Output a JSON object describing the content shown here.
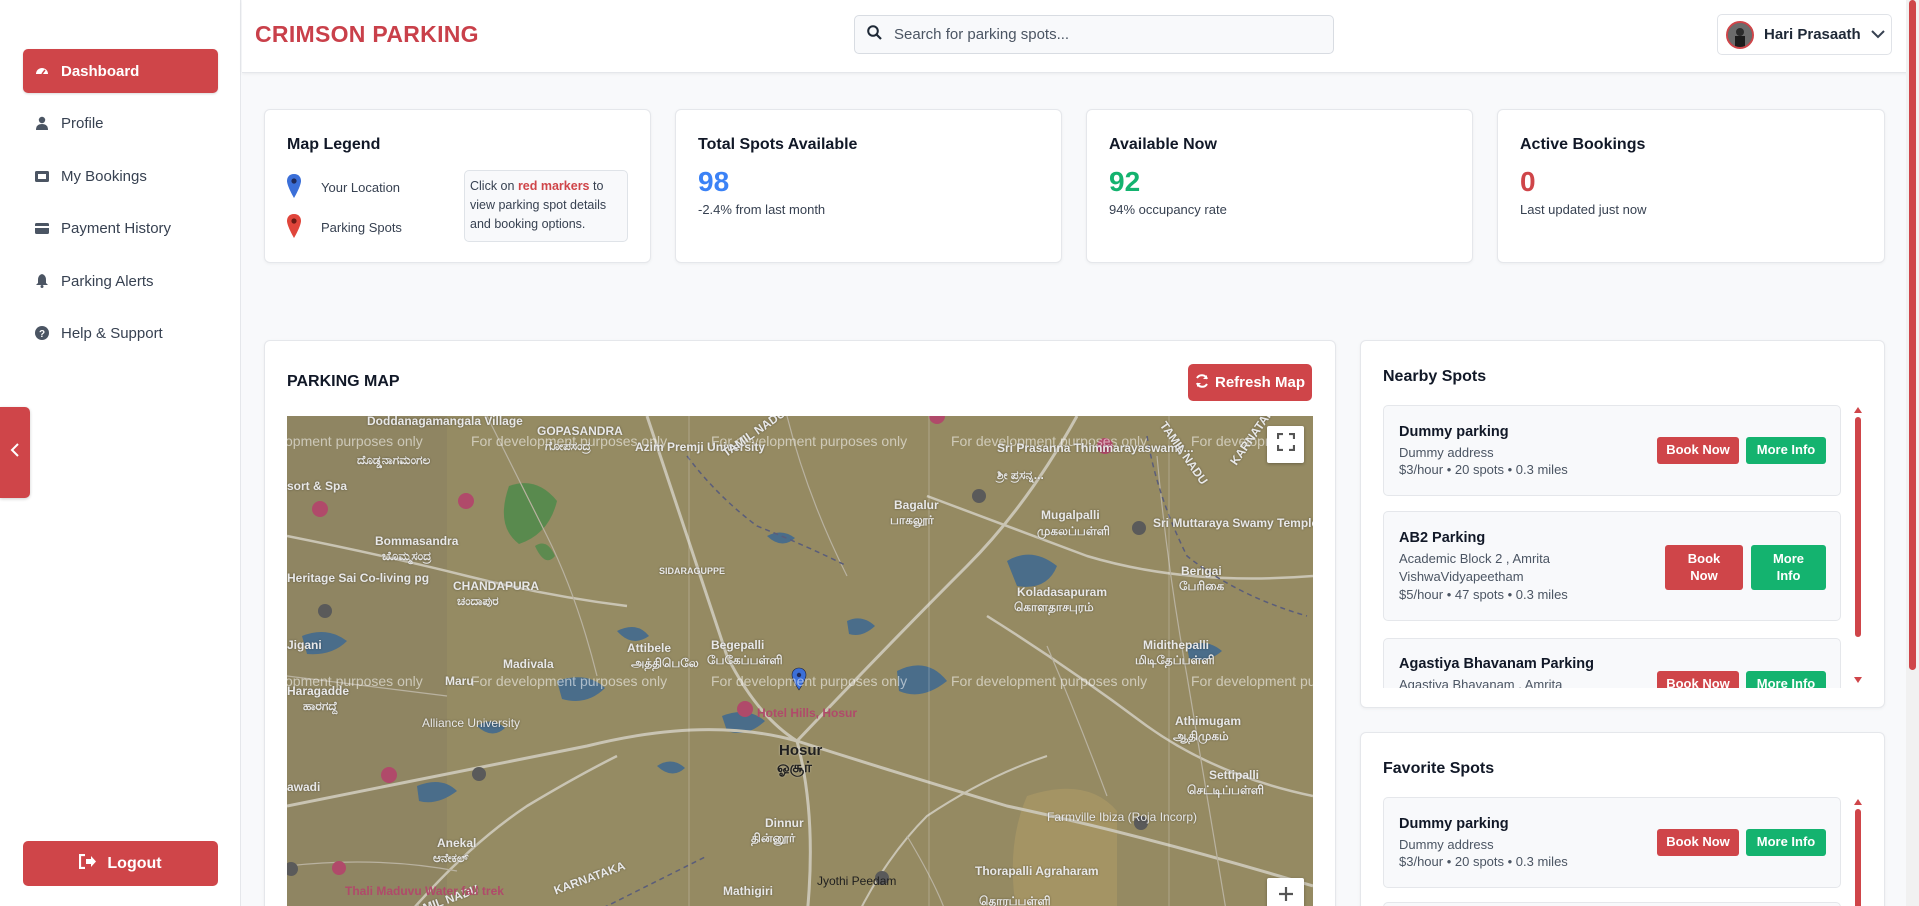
{
  "brand": "CRIMSON PARKING",
  "search": {
    "placeholder": "Search for parking spots..."
  },
  "user": {
    "name": "Hari Prasaath"
  },
  "sidebar": {
    "items": [
      {
        "label": "Dashboard",
        "icon": "dashboard-icon",
        "active": true
      },
      {
        "label": "Profile",
        "icon": "user-icon"
      },
      {
        "label": "My Bookings",
        "icon": "ticket-icon"
      },
      {
        "label": "Payment History",
        "icon": "credit-card-icon"
      },
      {
        "label": "Parking Alerts",
        "icon": "bell-icon"
      },
      {
        "label": "Help & Support",
        "icon": "question-circle-icon"
      }
    ],
    "logout": "Logout"
  },
  "legend": {
    "title": "Map Legend",
    "your_location": "Your Location",
    "parking_spots": "Parking Spots",
    "note_prefix": "Click on ",
    "note_highlight": "red markers",
    "note_suffix": " to view parking spot details and booking options."
  },
  "stats": [
    {
      "title": "Total Spots Available",
      "value": "98",
      "sub": "-2.4% from last month",
      "color": "#3b82f6"
    },
    {
      "title": "Available Now",
      "value": "92",
      "sub": "94% occupancy rate",
      "color": "#14b36f"
    },
    {
      "title": "Active Bookings",
      "value": "0",
      "sub": "Last updated just now",
      "color": "#cf4549"
    }
  ],
  "map_panel": {
    "title": "PARKING MAP",
    "refresh": "Refresh Map",
    "watermark": "For development purposes only",
    "watermark_clipped": "opment purposes only",
    "watermark_clipped_right": "For developm",
    "watermark_row2_right": "For development pu",
    "places": [
      "Doddanagamangala Village",
      "ದೊಡ್ಡನಾಗಮಂಗಲ",
      "sort & Spa",
      "GOPASANDRA",
      "ಗೋಪಸಂದ್ರ",
      "Azim Premji University",
      "TAMIL NADU",
      "Sri Prasanna Thimmarayaswamy...",
      "ಶ್ರೀ ಪ್ರಸನ್ನ...",
      "TAMIL NADU",
      "KARNATAKA",
      "Bagalur",
      "பாகலூர்",
      "Mugalpalli",
      "முகலப்பள்ளி",
      "Sri Muttaraya Swamy Temple",
      "Bommasandra",
      "ಬೊಮ್ಮಸಂದ್ರ",
      "Heritage Sai Co-living pg",
      "CHANDAPURA",
      "ಚಂದಾಪುರ",
      "SIDARAGUPPE",
      "Koladasapuram",
      "கொளதாசபுரம்",
      "Berigai",
      "பேரிகை",
      "Jigani",
      "Madivala",
      "Attibele",
      "அத்திபெலே",
      "Begepalli",
      "பேகேப்பள்ளி",
      "Midithepalli",
      "மிடிதேப்பள்ளி",
      "Haragadde",
      "ಹಾರಗದ್ದೆ",
      "Maru",
      "Alliance University",
      "Hotel Hills, Hosur",
      "Hosur",
      "ஓசூர்",
      "Athimugam",
      "ஆதிமுகம்",
      "Settipalli",
      "செட்டிப்பள்ளி",
      "awadi",
      "Dinnur",
      "தின்னூர்",
      "Farmville Ibiza (Roja Incorp)",
      "Anekal",
      "ಆನೇಕಲ್",
      "KARNATAKA",
      "TAMIL NADU",
      "Thali Maduvu Water fall trek",
      "Mathigiri",
      "Jyothi Peedam",
      "Thorapalli Agraharam",
      "தொரப்பள்ளி"
    ]
  },
  "nearby": {
    "title": "Nearby Spots",
    "spots": [
      {
        "name": "Dummy parking",
        "address": "Dummy address",
        "meta": "$3/hour • 20 spots • 0.3 miles"
      },
      {
        "name": "AB2 Parking",
        "address": "Academic Block 2 , Amrita VishwaVidyapeetham",
        "meta": "$5/hour • 47 spots • 0.3 miles"
      },
      {
        "name": "Agastiya Bhavanam Parking",
        "address": "Agastiya Bhavanam , Amrita"
      }
    ],
    "book": "Book Now",
    "info": "More Info"
  },
  "favorites": {
    "title": "Favorite Spots",
    "spots": [
      {
        "name": "Dummy parking",
        "address": "Dummy address",
        "meta": "$3/hour • 20 spots • 0.3 miles"
      }
    ]
  }
}
